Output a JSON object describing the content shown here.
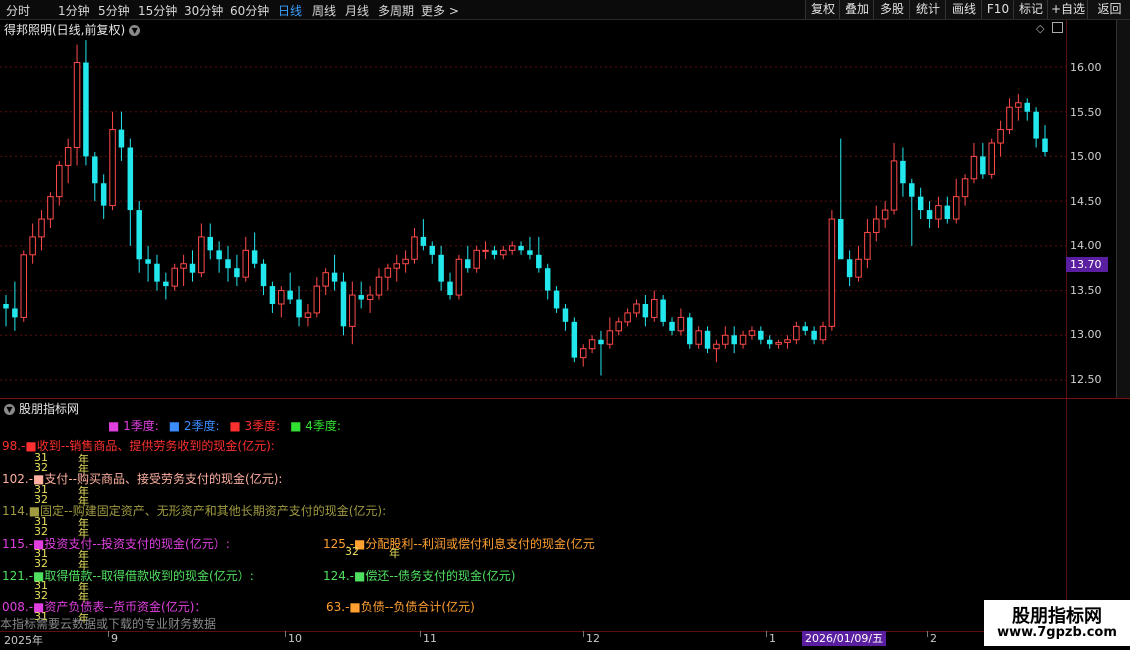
{
  "toolbar": {
    "timeframes": [
      "分时",
      "1分钟",
      "5分钟",
      "15分钟",
      "30分钟",
      "60分钟",
      "日线",
      "周线",
      "月线",
      "多周期",
      "更多 >"
    ],
    "active_timeframe": "日线",
    "buttons": [
      "复权",
      "叠加",
      "多股",
      "统计",
      "画线",
      "F10",
      "标记",
      "+自选",
      "返回"
    ]
  },
  "chart": {
    "title": "得邦照明(日线,前复权)",
    "price_ticks": [
      "16.00",
      "15.50",
      "15.00",
      "14.50",
      "14.00",
      "13.50",
      "13.00",
      "12.50"
    ],
    "current_price": "13.70"
  },
  "indicator": {
    "title": "股朋指标网",
    "legend": [
      {
        "label": "1季度:",
        "color": "#e040e0"
      },
      {
        "label": "2季度:",
        "color": "#3a8cff"
      },
      {
        "label": "3季度:",
        "color": "#ff3030"
      },
      {
        "label": "4季度:",
        "color": "#30e030"
      }
    ],
    "lines": {
      "l98": "98.-■收到--销售商品、提供劳务收到的现金(亿元):",
      "l102": "102.-■支付--购买商品、接受劳务支付的现金(亿元):",
      "l114": "114.■固定--购建固定资产、无形资产和其他长期资产支付的现金(亿元):",
      "l115": "115.-■投资支付--投资支付的现金(亿元）:",
      "l125": "125.-■分配股利--利润或偿付利息支付的现金(亿元",
      "l121": "121.-■取得借款--取得借款收到的现金(亿元）:",
      "l124": "124.-■偿还--债务支付的现金(亿元)",
      "l008": "008.-■资产负债表--货币资金(亿元)：",
      "l63": "63.-■负债--负债合计(亿元)"
    },
    "small": {
      "n31": "31",
      "n32": "32",
      "nian": "年"
    },
    "footnote": "本指标需要云数据或下载的专业财务数据"
  },
  "date_axis": {
    "labels": [
      "2025年",
      "9",
      "10",
      "11",
      "12",
      "1",
      "2"
    ],
    "cursor_date": "2026/01/09/五"
  },
  "watermark": {
    "name": "股朋指标网",
    "url": "www.7gpzb.com"
  },
  "colors": {
    "up": "#ff4a4a",
    "down": "#22e8ee",
    "grid": "#5a0f0f"
  },
  "chart_data": {
    "type": "candlestick",
    "title": "得邦照明(日线,前复权)",
    "ylim": [
      12.4,
      16.3
    ],
    "ohlc": [
      [
        13.35,
        13.45,
        13.1,
        13.3
      ],
      [
        13.3,
        13.6,
        13.05,
        13.2
      ],
      [
        13.2,
        13.95,
        13.15,
        13.9
      ],
      [
        13.9,
        14.25,
        13.8,
        14.1
      ],
      [
        14.1,
        14.4,
        13.95,
        14.3
      ],
      [
        14.3,
        14.6,
        14.2,
        14.55
      ],
      [
        14.55,
        14.95,
        14.45,
        14.9
      ],
      [
        14.9,
        15.2,
        14.7,
        15.1
      ],
      [
        15.1,
        16.25,
        14.9,
        16.05
      ],
      [
        16.05,
        16.3,
        14.9,
        15.0
      ],
      [
        15.0,
        15.05,
        14.5,
        14.7
      ],
      [
        14.7,
        14.8,
        14.3,
        14.45
      ],
      [
        14.45,
        15.5,
        14.4,
        15.3
      ],
      [
        15.3,
        15.5,
        14.95,
        15.1
      ],
      [
        15.1,
        15.2,
        14.0,
        14.4
      ],
      [
        14.4,
        14.5,
        13.7,
        13.85
      ],
      [
        13.85,
        14.0,
        13.6,
        13.8
      ],
      [
        13.8,
        13.9,
        13.5,
        13.6
      ],
      [
        13.6,
        13.7,
        13.4,
        13.55
      ],
      [
        13.55,
        13.8,
        13.5,
        13.75
      ],
      [
        13.75,
        13.9,
        13.55,
        13.8
      ],
      [
        13.8,
        13.95,
        13.6,
        13.7
      ],
      [
        13.7,
        14.25,
        13.65,
        14.1
      ],
      [
        14.1,
        14.25,
        13.85,
        13.95
      ],
      [
        13.95,
        14.05,
        13.7,
        13.85
      ],
      [
        13.85,
        14.0,
        13.6,
        13.75
      ],
      [
        13.75,
        13.9,
        13.55,
        13.65
      ],
      [
        13.65,
        14.1,
        13.6,
        13.95
      ],
      [
        13.95,
        14.15,
        13.75,
        13.8
      ],
      [
        13.8,
        13.85,
        13.45,
        13.55
      ],
      [
        13.55,
        13.6,
        13.25,
        13.35
      ],
      [
        13.35,
        13.55,
        13.2,
        13.5
      ],
      [
        13.5,
        13.7,
        13.35,
        13.4
      ],
      [
        13.4,
        13.55,
        13.1,
        13.2
      ],
      [
        13.2,
        13.35,
        13.1,
        13.25
      ],
      [
        13.25,
        13.65,
        13.2,
        13.55
      ],
      [
        13.55,
        13.75,
        13.45,
        13.7
      ],
      [
        13.7,
        13.9,
        13.5,
        13.6
      ],
      [
        13.6,
        13.7,
        13.0,
        13.1
      ],
      [
        13.1,
        13.6,
        12.9,
        13.45
      ],
      [
        13.45,
        13.6,
        13.3,
        13.4
      ],
      [
        13.4,
        13.55,
        13.25,
        13.45
      ],
      [
        13.45,
        13.75,
        13.4,
        13.65
      ],
      [
        13.65,
        13.8,
        13.5,
        13.75
      ],
      [
        13.75,
        13.9,
        13.6,
        13.8
      ],
      [
        13.8,
        13.95,
        13.7,
        13.85
      ],
      [
        13.85,
        14.2,
        13.8,
        14.1
      ],
      [
        14.1,
        14.3,
        13.95,
        14.0
      ],
      [
        14.0,
        14.05,
        13.8,
        13.9
      ],
      [
        13.9,
        14.0,
        13.5,
        13.6
      ],
      [
        13.6,
        13.7,
        13.4,
        13.45
      ],
      [
        13.45,
        13.9,
        13.4,
        13.85
      ],
      [
        13.85,
        14.0,
        13.7,
        13.75
      ],
      [
        13.75,
        14.0,
        13.7,
        13.95
      ],
      [
        13.95,
        14.05,
        13.85,
        13.95
      ],
      [
        13.95,
        14.0,
        13.85,
        13.9
      ],
      [
        13.9,
        14.0,
        13.85,
        13.95
      ],
      [
        13.95,
        14.05,
        13.9,
        14.0
      ],
      [
        14.0,
        14.05,
        13.9,
        13.95
      ],
      [
        13.95,
        14.1,
        13.85,
        13.9
      ],
      [
        13.9,
        14.1,
        13.7,
        13.75
      ],
      [
        13.75,
        13.8,
        13.4,
        13.5
      ],
      [
        13.5,
        13.55,
        13.25,
        13.3
      ],
      [
        13.3,
        13.35,
        13.05,
        13.15
      ],
      [
        13.15,
        13.2,
        12.7,
        12.75
      ],
      [
        12.75,
        12.9,
        12.65,
        12.85
      ],
      [
        12.85,
        13.0,
        12.8,
        12.95
      ],
      [
        12.95,
        13.05,
        12.55,
        12.9
      ],
      [
        12.9,
        13.2,
        12.85,
        13.05
      ],
      [
        13.05,
        13.2,
        13.0,
        13.15
      ],
      [
        13.15,
        13.3,
        13.1,
        13.25
      ],
      [
        13.25,
        13.4,
        13.2,
        13.35
      ],
      [
        13.35,
        13.45,
        13.1,
        13.2
      ],
      [
        13.2,
        13.5,
        13.15,
        13.4
      ],
      [
        13.4,
        13.45,
        13.1,
        13.15
      ],
      [
        13.15,
        13.2,
        13.0,
        13.05
      ],
      [
        13.05,
        13.3,
        13.0,
        13.2
      ],
      [
        13.2,
        13.25,
        12.85,
        12.9
      ],
      [
        12.9,
        13.1,
        12.85,
        13.05
      ],
      [
        13.05,
        13.1,
        12.8,
        12.85
      ],
      [
        12.85,
        12.95,
        12.7,
        12.9
      ],
      [
        12.9,
        13.1,
        12.85,
        13.0
      ],
      [
        13.0,
        13.1,
        12.8,
        12.9
      ],
      [
        12.9,
        13.05,
        12.85,
        13.0
      ],
      [
        13.0,
        13.1,
        12.95,
        13.05
      ],
      [
        13.05,
        13.1,
        12.9,
        12.95
      ],
      [
        12.95,
        13.0,
        12.85,
        12.9
      ],
      [
        12.9,
        12.95,
        12.85,
        12.92
      ],
      [
        12.92,
        13.0,
        12.85,
        12.95
      ],
      [
        12.95,
        13.15,
        12.9,
        13.1
      ],
      [
        13.1,
        13.15,
        13.0,
        13.05
      ],
      [
        13.05,
        13.1,
        12.9,
        12.95
      ],
      [
        12.95,
        13.15,
        12.9,
        13.1
      ],
      [
        13.1,
        14.4,
        13.05,
        14.3
      ],
      [
        14.3,
        15.2,
        13.9,
        13.85
      ],
      [
        13.85,
        13.95,
        13.55,
        13.65
      ],
      [
        13.65,
        14.0,
        13.6,
        13.85
      ],
      [
        13.85,
        14.3,
        13.75,
        14.15
      ],
      [
        14.15,
        14.45,
        14.05,
        14.3
      ],
      [
        14.3,
        14.5,
        14.2,
        14.4
      ],
      [
        14.4,
        15.15,
        14.35,
        14.95
      ],
      [
        14.95,
        15.1,
        14.55,
        14.7
      ],
      [
        14.7,
        14.75,
        14.0,
        14.55
      ],
      [
        14.55,
        14.65,
        14.3,
        14.4
      ],
      [
        14.4,
        14.5,
        14.2,
        14.3
      ],
      [
        14.3,
        14.55,
        14.2,
        14.45
      ],
      [
        14.45,
        14.55,
        14.25,
        14.3
      ],
      [
        14.3,
        14.75,
        14.25,
        14.55
      ],
      [
        14.55,
        14.8,
        14.45,
        14.75
      ],
      [
        14.75,
        15.15,
        14.7,
        15.0
      ],
      [
        15.0,
        15.15,
        14.75,
        14.8
      ],
      [
        14.8,
        15.2,
        14.75,
        15.15
      ],
      [
        15.15,
        15.4,
        15.0,
        15.3
      ],
      [
        15.3,
        15.65,
        15.25,
        15.55
      ],
      [
        15.55,
        15.7,
        15.4,
        15.6
      ],
      [
        15.6,
        15.65,
        15.4,
        15.5
      ],
      [
        15.5,
        15.55,
        15.1,
        15.2
      ],
      [
        15.2,
        15.35,
        15.0,
        15.05
      ]
    ]
  }
}
